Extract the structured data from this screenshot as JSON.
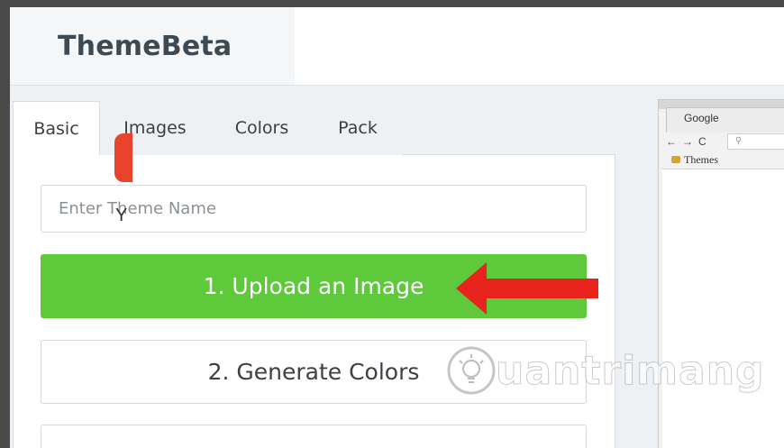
{
  "app": {
    "title": "ThemeBeta"
  },
  "tabs": [
    {
      "label": "Basic",
      "active": true
    },
    {
      "label": "Images",
      "active": false
    },
    {
      "label": "Colors",
      "active": false
    },
    {
      "label": "Pack",
      "active": false
    }
  ],
  "form": {
    "theme_name": {
      "value": "",
      "placeholder": "Enter Theme Name"
    },
    "upload_label": "1. Upload an Image",
    "generate_label": "2. Generate Colors"
  },
  "preview": {
    "tab_title": "Google",
    "nav": {
      "back": "←",
      "forward": "→",
      "reload": "C",
      "search": "⚲"
    },
    "bookmark_label": "Themes",
    "peek_text": "Y"
  },
  "watermark": {
    "text": "uantrimang"
  },
  "colors": {
    "brand_text": "#3d4a54",
    "upload_button": "#5dc93b",
    "arrow": "#e8231c",
    "preview_accent": "#e8432c"
  }
}
